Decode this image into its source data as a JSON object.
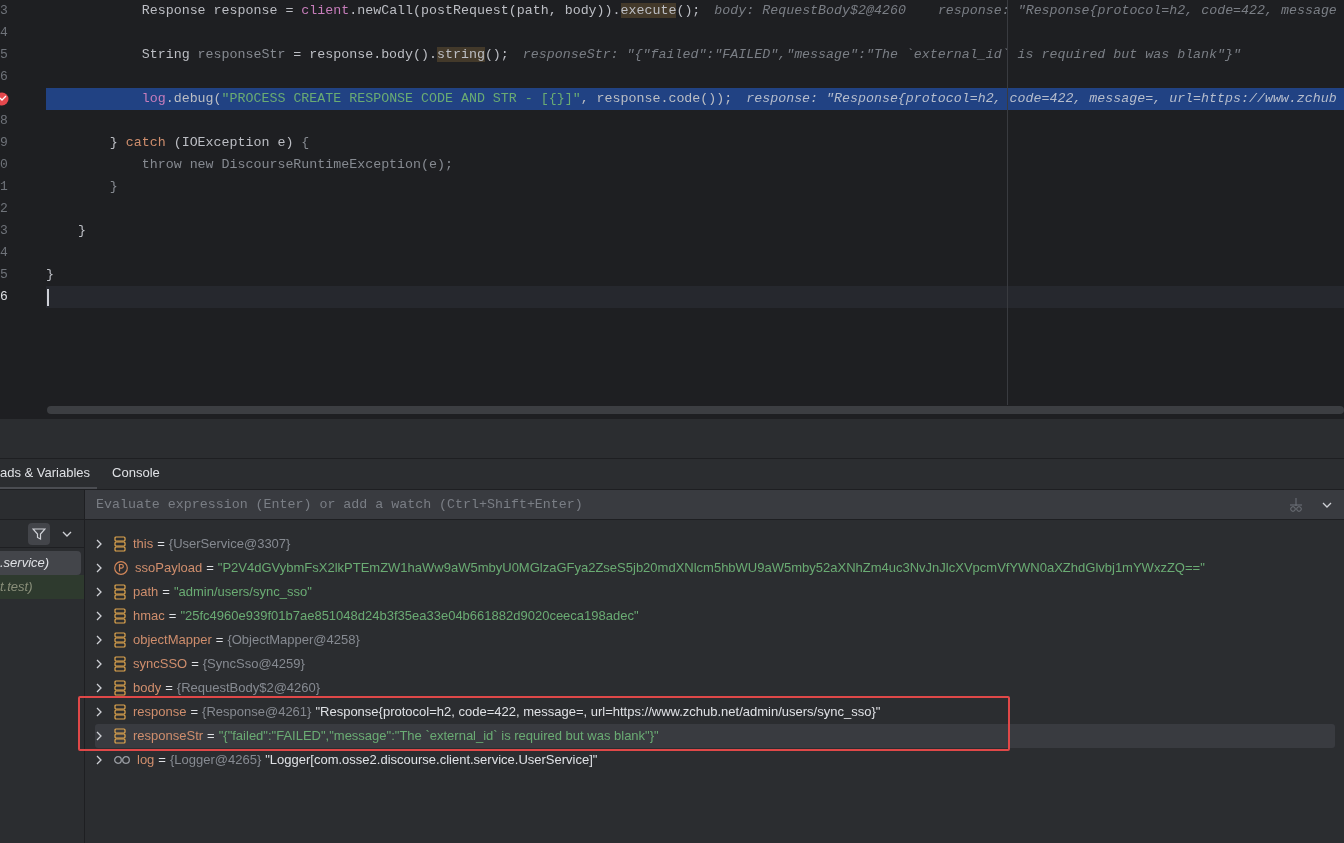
{
  "editor": {
    "lines": [
      {
        "number": "3",
        "tokens": [
          {
            "text": "            Response response = ",
            "kind": "plain"
          },
          {
            "text": "client",
            "kind": "field"
          },
          {
            "text": ".newCall(postRequest(path, body)).",
            "kind": "plain"
          },
          {
            "text": "execute",
            "kind": "usage"
          },
          {
            "text": "();",
            "kind": "plain"
          }
        ],
        "hints": [
          "body: RequestBody$2@4260",
          "response: \"Response{protocol=h2, code=422, message"
        ]
      },
      {
        "number": "4"
      },
      {
        "number": "5",
        "tokens": [
          {
            "text": "            String ",
            "kind": "plain"
          },
          {
            "text": "responseStr",
            "kind": "unused"
          },
          {
            "text": " = response.body().",
            "kind": "plain"
          },
          {
            "text": "string",
            "kind": "usage"
          },
          {
            "text": "();",
            "kind": "plain"
          }
        ],
        "hints": [
          "responseStr: \"{\"failed\":\"FAILED\",\"message\":\"The `external_id` is required but was blank\"}\""
        ]
      },
      {
        "number": "6"
      },
      {
        "breakpoint": true,
        "current": true,
        "tokens": [
          {
            "text": "            log",
            "kind": "field"
          },
          {
            "text": ".debug(",
            "kind": "plain"
          },
          {
            "text": "\"PROCESS CREATE RESPONSE CODE AND STR - [{}]\"",
            "kind": "string"
          },
          {
            "text": ", response.code());",
            "kind": "plain"
          }
        ],
        "hints": [
          "response: \"Response{protocol=h2, code=422, message=, url=https://www.zchub"
        ]
      },
      {
        "number": "8"
      },
      {
        "number": "9",
        "tokens": [
          {
            "text": "        } ",
            "kind": "plain"
          },
          {
            "text": "catch",
            "kind": "keyword"
          },
          {
            "text": " (IOException e) ",
            "kind": "plain"
          },
          {
            "text": "{",
            "kind": "dim"
          }
        ]
      },
      {
        "number": "0",
        "tokens": [
          {
            "text": "            throw new DiscourseRuntimeException(e);",
            "kind": "dim"
          }
        ]
      },
      {
        "number": "1",
        "tokens": [
          {
            "text": "        }",
            "kind": "dim"
          }
        ]
      },
      {
        "number": "2"
      },
      {
        "number": "3",
        "tokens": [
          {
            "text": "    }",
            "kind": "plain"
          }
        ]
      },
      {
        "number": "4"
      },
      {
        "number": "5",
        "tokens": [
          {
            "text": "}",
            "kind": "plain"
          }
        ]
      },
      {
        "number": "6",
        "caret": true
      }
    ]
  },
  "debug": {
    "tabs": [
      {
        "label": "ads & Variables",
        "selected": true
      },
      {
        "label": "Console",
        "selected": false
      }
    ],
    "frames": [
      {
        "label": ".service)",
        "selected": true,
        "kind": "frame"
      },
      {
        "label": "t.test)",
        "selected": false,
        "kind": "library"
      }
    ],
    "evaluate": {
      "placeholder": "Evaluate expression (Enter) or add a watch (Ctrl+Shift+Enter)"
    },
    "variables": [
      {
        "kind": "field",
        "name": "this",
        "operator": "=",
        "type": "{UserService@3307}",
        "selected": false
      },
      {
        "kind": "parameter",
        "name": "ssoPayload",
        "operator": "=",
        "string_value": "\"P2V4dGVybmFsX2lkPTEmZW1haWw9aW5mbyU0MGlzaGFya2ZseS5jb20mdXNlcm5hbWU9aW5mby52aXNhZm4uc3NvJnJlcXVpcmVfYWN0aXZhdGlvbj1mYWxzZQ==\"",
        "selected": false
      },
      {
        "kind": "field",
        "name": "path",
        "operator": "=",
        "string_value": "\"admin/users/sync_sso\"",
        "selected": false
      },
      {
        "kind": "field",
        "name": "hmac",
        "operator": "=",
        "string_value": "\"25fc4960e939f01b7ae851048d24b3f35ea33e04b661882d9020ceeca198adec\"",
        "selected": false
      },
      {
        "kind": "field",
        "name": "objectMapper",
        "operator": "=",
        "type": "{ObjectMapper@4258}",
        "selected": false
      },
      {
        "kind": "field",
        "name": "syncSSO",
        "operator": "=",
        "type": "{SyncSso@4259}",
        "selected": false
      },
      {
        "kind": "field",
        "name": "body",
        "operator": "=",
        "type": "{RequestBody$2@4260}",
        "selected": false
      },
      {
        "kind": "field",
        "name": "response",
        "operator": "=",
        "type": "{Response@4261}",
        "value": "\"Response{protocol=h2, code=422, message=, url=https://www.zchub.net/admin/users/sync_sso}\"",
        "selected": false
      },
      {
        "kind": "field",
        "name": "responseStr",
        "operator": "=",
        "string_value": "\"{\"failed\":\"FAILED\",\"message\":\"The `external_id` is required but was blank\"}\"",
        "selected": true
      },
      {
        "kind": "static",
        "name": "log",
        "operator": "=",
        "type": "{Logger@4265}",
        "value": "\"Logger[com.osse2.discourse.client.service.UserService]\"",
        "selected": false
      }
    ]
  },
  "annotation_frame": true
}
